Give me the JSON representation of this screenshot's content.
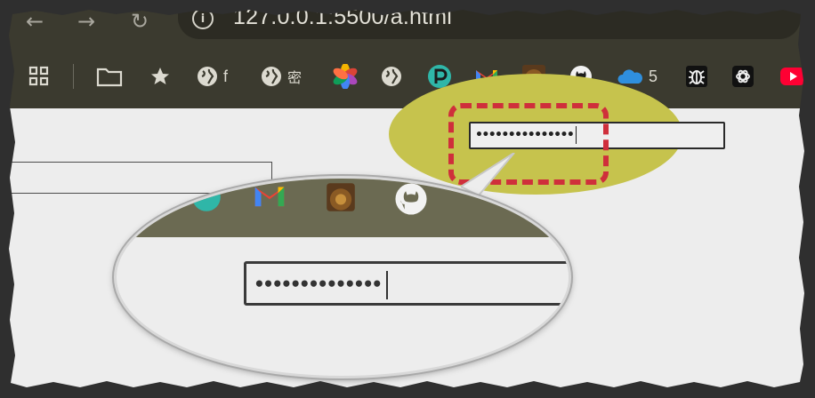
{
  "browser": {
    "nav": {
      "back": "←",
      "forward": "→",
      "reload": "↻"
    },
    "address_bar": {
      "url": "127.0.0.1:5500/a.html",
      "info_icon": "i"
    },
    "bookmarks": [
      {
        "icon": "apps-grid-icon",
        "label": ""
      },
      {
        "icon": "folder-icon",
        "label": ""
      },
      {
        "icon": "star-icon",
        "label": ""
      },
      {
        "icon": "globe-icon",
        "label": "f"
      },
      {
        "icon": "globe-icon",
        "label": "密"
      },
      {
        "icon": "pinwheel-icon",
        "label": ""
      },
      {
        "icon": "globe-icon",
        "label": ""
      },
      {
        "icon": "p-logo-icon",
        "label": ""
      },
      {
        "icon": "gmail-icon",
        "label": ""
      },
      {
        "icon": "avatar-icon",
        "label": ""
      },
      {
        "icon": "github-icon",
        "label": ""
      },
      {
        "icon": "cloud-icon",
        "label": "5"
      },
      {
        "icon": "bug-icon",
        "label": ""
      },
      {
        "icon": "openai-icon",
        "label": ""
      },
      {
        "icon": "youtube-icon",
        "label": ""
      }
    ]
  },
  "page": {
    "password_field": {
      "value": "•••••••••••••••"
    },
    "magnified_password_field": {
      "value": "••••••••••••••"
    }
  },
  "colors": {
    "highlight": "#c6c34d",
    "dashed_outline": "#cf2f3b",
    "chrome": "#3b3a2f",
    "page_bg": "#ededed"
  }
}
